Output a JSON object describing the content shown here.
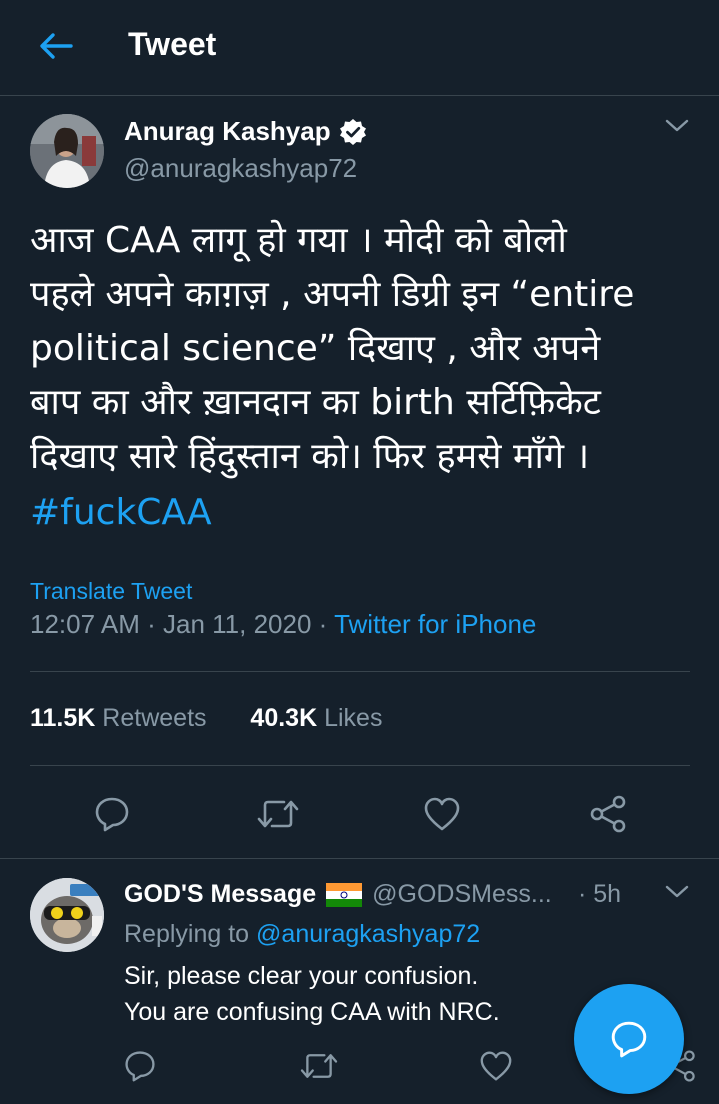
{
  "header": {
    "title": "Tweet",
    "back_icon": "arrow-left-icon"
  },
  "tweet": {
    "author_name": "Anurag Kashyap",
    "author_handle": "@anuragkashyap72",
    "verified": true,
    "text": "आज CAA लागू हो गया । मोदी को बोलो\nपहले अपने काग़ज़ , अपनी डिग्री इन “entire\npolitical science” दिखाए , और अपने\nबाप का और ख़ानदान का birth सर्टिफ़िकेट\nदिखाए सारे हिंदुस्तान को। फिर हमसे माँगे ।",
    "hashtag": "#fuckCAA",
    "translate_label": "Translate Tweet",
    "time": "12:07 AM",
    "date": "Jan 11, 2020",
    "source": "Twitter for iPhone",
    "retweets_count": "11.5K",
    "retweets_label": "Retweets",
    "likes_count": "40.3K",
    "likes_label": "Likes"
  },
  "reply": {
    "author_name": "GOD'S Message",
    "author_handle": "@GODSMess...",
    "time": "· 5h",
    "replying_prefix": "Replying to",
    "replying_to": "@anuragkashyap72",
    "line1": "Sir, please clear your confusion.",
    "line2": "You are confusing CAA with NRC."
  },
  "colors": {
    "background": "#15202b",
    "accent": "#1da1f2",
    "secondary_text": "#8899a6",
    "divider": "#38444d"
  },
  "icons": [
    "arrow-left-icon",
    "verified-badge-icon",
    "chevron-down-icon",
    "reply-icon",
    "retweet-icon",
    "like-icon",
    "share-icon",
    "india-flag-icon",
    "compose-reply-icon"
  ]
}
